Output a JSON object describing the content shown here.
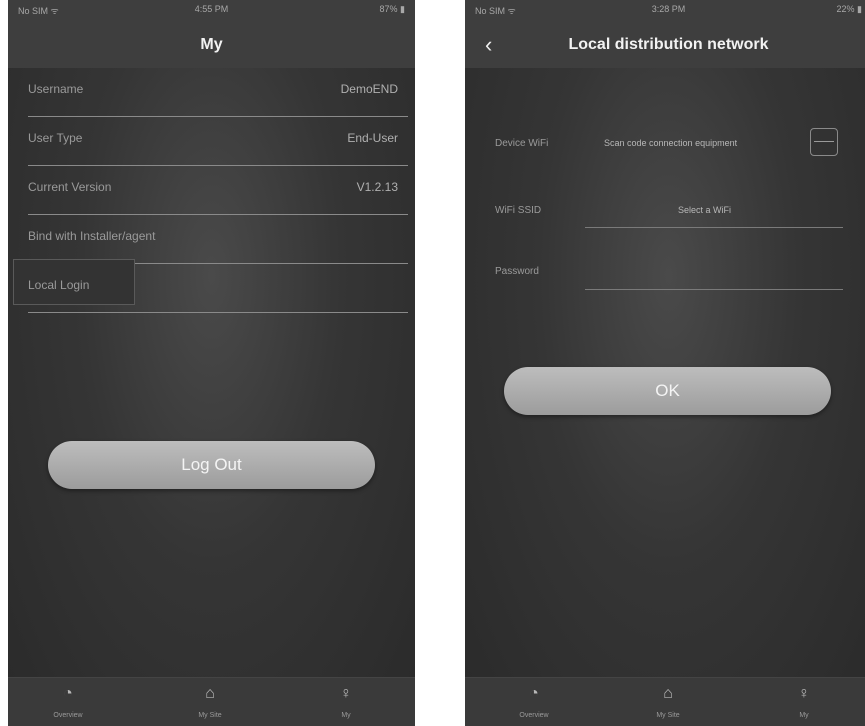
{
  "left": {
    "status": {
      "carrier": "No SIM ᯤ",
      "time": "4:55 PM",
      "battery": "87% ▮"
    },
    "title": "My",
    "rows": [
      {
        "label": "Username",
        "value": "DemoEND"
      },
      {
        "label": "User Type",
        "value": "End-User"
      },
      {
        "label": "Current Version",
        "value": "V1.2.13"
      },
      {
        "label": "Bind with Installer/agent",
        "value": ""
      },
      {
        "label": "Local Login",
        "value": ""
      }
    ],
    "logout_label": "Log Out",
    "tabs": [
      {
        "icon": "◔",
        "label": "Overview"
      },
      {
        "icon": "⌂",
        "label": "My Site"
      },
      {
        "icon": "♀",
        "label": "My"
      }
    ]
  },
  "right": {
    "status": {
      "carrier": "No SIM ᯤ",
      "time": "3:28 PM",
      "battery": "22% ▮"
    },
    "back_icon": "‹",
    "title": "Local distribution network",
    "device_wifi_label": "Device WiFi",
    "device_wifi_value": "Scan code connection equipment",
    "ssid_label": "WiFi SSID",
    "ssid_value": "Select a WiFi",
    "password_label": "Password",
    "password_value": "",
    "ok_label": "OK",
    "tabs": [
      {
        "icon": "◔",
        "label": "Overview"
      },
      {
        "icon": "⌂",
        "label": "My Site"
      },
      {
        "icon": "♀",
        "label": "My"
      }
    ]
  }
}
